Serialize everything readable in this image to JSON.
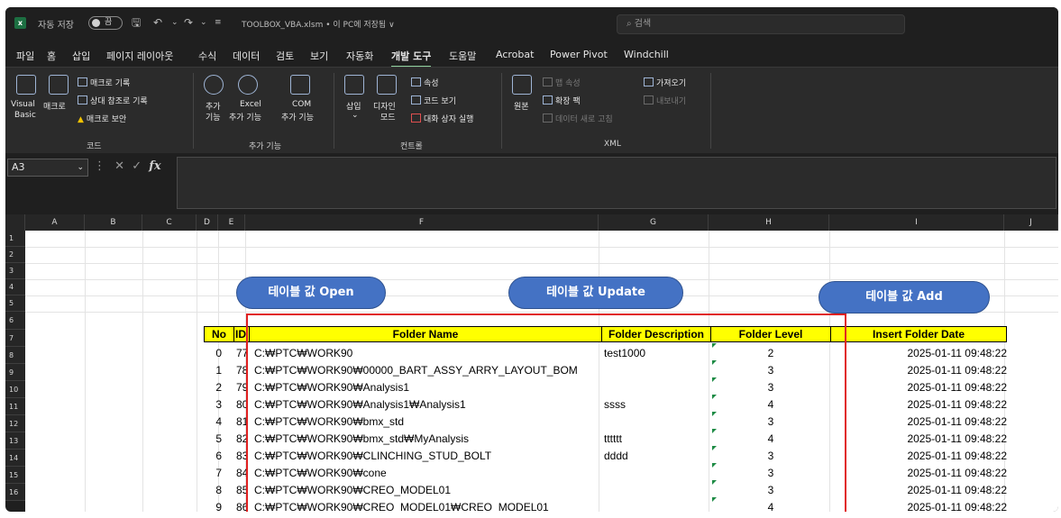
{
  "titlebar": {
    "autosave_label": "자동 저장",
    "toggle_text": "끔",
    "filename": "TOOLBOX_VBA.xlsm • 이 PC에 저장됨 ∨",
    "search_placeholder": "검색"
  },
  "tabs": [
    "파일",
    "홈",
    "삽입",
    "페이지 레이아웃",
    "수식",
    "데이터",
    "검토",
    "보기",
    "자동화",
    "개발 도구",
    "도움말",
    "Acrobat",
    "Power Pivot",
    "Windchill"
  ],
  "active_tab": "개발 도구",
  "ribbon": {
    "code": {
      "visual_basic_1": "Visual",
      "visual_basic_2": "Basic",
      "macro": "매크로",
      "record_macro": "매크로 기록",
      "relative_ref": "상대 참조로 기록",
      "macro_security": "매크로 보안",
      "group_label": "코드"
    },
    "addins": {
      "add_1": "추가",
      "add_2": "기능",
      "excel_1": "Excel",
      "excel_2": "추가 기능",
      "com_1": "COM",
      "com_2": "추가 기능",
      "group_label": "추가 기능"
    },
    "controls": {
      "insert": "삽입",
      "design_1": "디자인",
      "design_2": "모드",
      "properties": "속성",
      "view_code": "코드 보기",
      "run_dialog": "대화 상자 실행",
      "group_label": "컨트롤"
    },
    "xml": {
      "source": "원본",
      "map_properties": "맵 속성",
      "expansion_packs": "확장 팩",
      "refresh_data": "데이터 새로 고침",
      "import": "가져오기",
      "export": "내보내기",
      "group_label": "XML"
    }
  },
  "formula_bar": {
    "name_box": "A3",
    "fx": "fx"
  },
  "columns": [
    "A",
    "B",
    "C",
    "D",
    "E",
    "F",
    "G",
    "H",
    "I",
    "J"
  ],
  "rows": [
    "1",
    "2",
    "3",
    "4",
    "5",
    "6",
    "7",
    "8",
    "9",
    "10",
    "11",
    "12",
    "13",
    "14",
    "15",
    "16"
  ],
  "buttons": {
    "open": "테이블 값 Open",
    "update": "테이블 값 Update",
    "add": "테이블 값 Add"
  },
  "table": {
    "headers": [
      "No",
      "ID",
      "Folder Name",
      "Folder Description",
      "Folder Level",
      "Insert Folder Date"
    ],
    "rows": [
      {
        "no": "0",
        "id": "77",
        "name": "C:₩PTC₩WORK90",
        "desc": "test1000",
        "level": "2",
        "date": "2025-01-11 09:48:22"
      },
      {
        "no": "1",
        "id": "78",
        "name": "C:₩PTC₩WORK90₩00000_BART_ASSY_ARRY_LAYOUT_BOM",
        "desc": "",
        "level": "3",
        "date": "2025-01-11 09:48:22"
      },
      {
        "no": "2",
        "id": "79",
        "name": "C:₩PTC₩WORK90₩Analysis1",
        "desc": "",
        "level": "3",
        "date": "2025-01-11 09:48:22"
      },
      {
        "no": "3",
        "id": "80",
        "name": "C:₩PTC₩WORK90₩Analysis1₩Analysis1",
        "desc": "ssss",
        "level": "4",
        "date": "2025-01-11 09:48:22"
      },
      {
        "no": "4",
        "id": "81",
        "name": "C:₩PTC₩WORK90₩bmx_std",
        "desc": "",
        "level": "3",
        "date": "2025-01-11 09:48:22"
      },
      {
        "no": "5",
        "id": "82",
        "name": "C:₩PTC₩WORK90₩bmx_std₩MyAnalysis",
        "desc": "tttttt",
        "level": "4",
        "date": "2025-01-11 09:48:22"
      },
      {
        "no": "6",
        "id": "83",
        "name": "C:₩PTC₩WORK90₩CLINCHING_STUD_BOLT",
        "desc": "dddd",
        "level": "3",
        "date": "2025-01-11 09:48:22"
      },
      {
        "no": "7",
        "id": "84",
        "name": "C:₩PTC₩WORK90₩cone",
        "desc": "",
        "level": "3",
        "date": "2025-01-11 09:48:22"
      },
      {
        "no": "8",
        "id": "85",
        "name": "C:₩PTC₩WORK90₩CREO_MODEL01",
        "desc": "",
        "level": "3",
        "date": "2025-01-11 09:48:22"
      },
      {
        "no": "9",
        "id": "86",
        "name": "C:₩PTC₩WORK90₩CREO_MODEL01₩CREO_MODEL01",
        "desc": "",
        "level": "4",
        "date": "2025-01-11 09:48:22"
      }
    ]
  },
  "colors": {
    "header_fill": "#ffff00",
    "button_fill": "#4472c4",
    "highlight_border": "#e02020",
    "active_tab_underline": "#8fd19e"
  }
}
